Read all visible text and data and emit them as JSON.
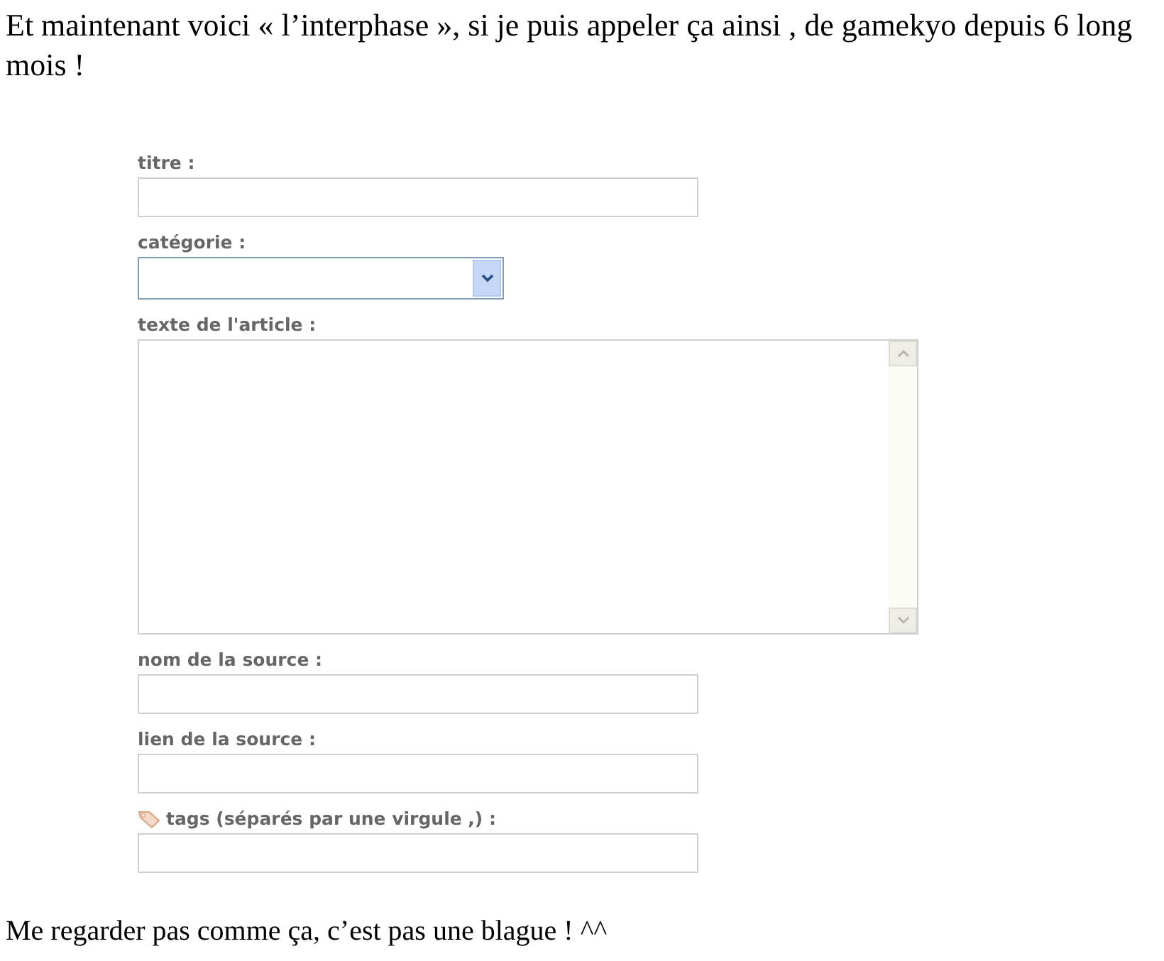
{
  "intro": "Et maintenant voici « l’interphase », si je puis appeler ça ainsi , de gamekyo depuis 6 long mois !",
  "fields": [
    {
      "kind": "text",
      "label": "titre :"
    },
    {
      "kind": "select",
      "label": "catégorie :"
    },
    {
      "kind": "textarea",
      "label": "texte de l'article :"
    },
    {
      "kind": "text",
      "label": "nom de la source :"
    },
    {
      "kind": "text",
      "label": "lien de la source :"
    },
    {
      "kind": "text",
      "label": "tags (séparés par une virgule ,) :",
      "icon": true
    }
  ],
  "outro": "Me regarder pas comme ça, c’est pas une blague ! ^^"
}
